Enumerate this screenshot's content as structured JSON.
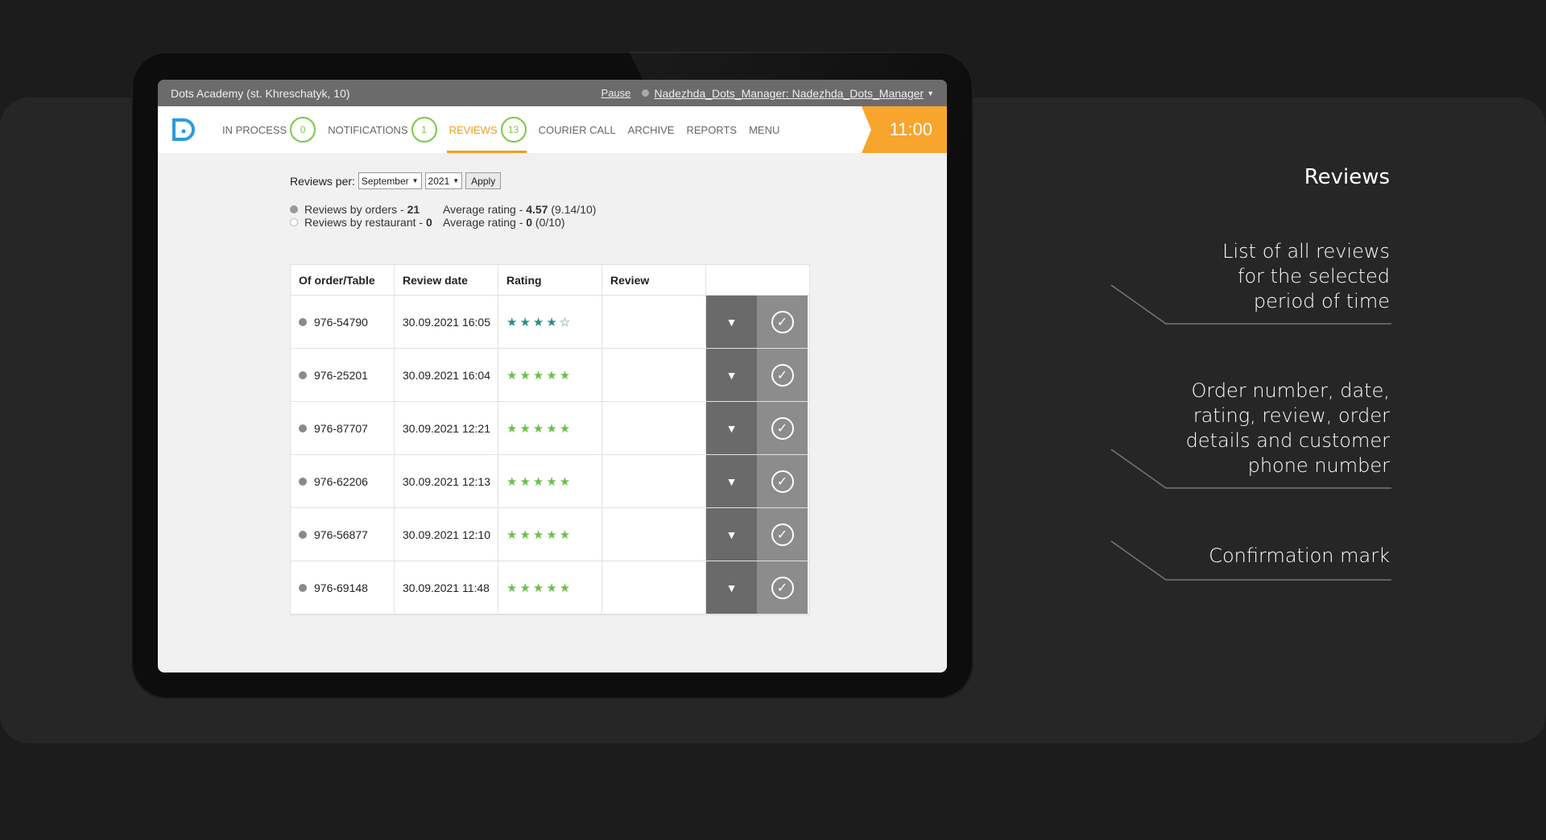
{
  "topbar": {
    "location": "Dots Academy (st. Khreschatyk, 10)",
    "pause": "Pause",
    "user": "Nadezhda_Dots_Manager: Nadezhda_Dots_Manager"
  },
  "nav": {
    "in_process": {
      "label": "IN PROCESS",
      "count": "0"
    },
    "notifications": {
      "label": "NOTIFICATIONS",
      "count": "1"
    },
    "reviews": {
      "label": "REVIEWS",
      "count": "13"
    },
    "courier_call": "COURIER CALL",
    "archive": "ARCHIVE",
    "reports": "REPORTS",
    "menu": "MENU",
    "time": "11:00"
  },
  "filter": {
    "label": "Reviews per:",
    "month": "September",
    "year": "2021",
    "apply": "Apply"
  },
  "stats": {
    "orders_label": "Reviews by orders - ",
    "orders_count": "21",
    "orders_avg_label": "Average rating - ",
    "orders_avg": "4.57",
    "orders_avg_10": " (9.14/10)",
    "restaurant_label": "Reviews by restaurant - ",
    "restaurant_count": "0",
    "restaurant_avg_label": "Average rating - ",
    "restaurant_avg": "0",
    "restaurant_avg_10": " (0/10)"
  },
  "table": {
    "headers": [
      "Of order/Table",
      "Review date",
      "Rating",
      "Review"
    ],
    "rows": [
      {
        "order": "976-54790",
        "date": "30.09.2021 16:05",
        "stars": "★★★★☆",
        "rating": 4
      },
      {
        "order": "976-25201",
        "date": "30.09.2021 16:04",
        "stars": "★★★★★",
        "rating": 5
      },
      {
        "order": "976-87707",
        "date": "30.09.2021 12:21",
        "stars": "★★★★★",
        "rating": 5
      },
      {
        "order": "976-62206",
        "date": "30.09.2021 12:13",
        "stars": "★★★★★",
        "rating": 5
      },
      {
        "order": "976-56877",
        "date": "30.09.2021 12:10",
        "stars": "★★★★★",
        "rating": 5
      },
      {
        "order": "976-69148",
        "date": "30.09.2021 11:48",
        "stars": "★★★★★",
        "rating": 5
      }
    ]
  },
  "annotations": {
    "title": "Reviews",
    "a1": [
      "List of all reviews",
      "for the selected",
      "period of time"
    ],
    "a2": [
      "Order number, date,",
      "rating, review, order",
      "details and customer",
      "phone number"
    ],
    "a3": [
      "Confirmation mark"
    ]
  },
  "colors": {
    "accent": "#f59b1f",
    "badge": "#7ac943",
    "star_green": "#6cc04a",
    "star_teal": "#2a8c8c"
  }
}
